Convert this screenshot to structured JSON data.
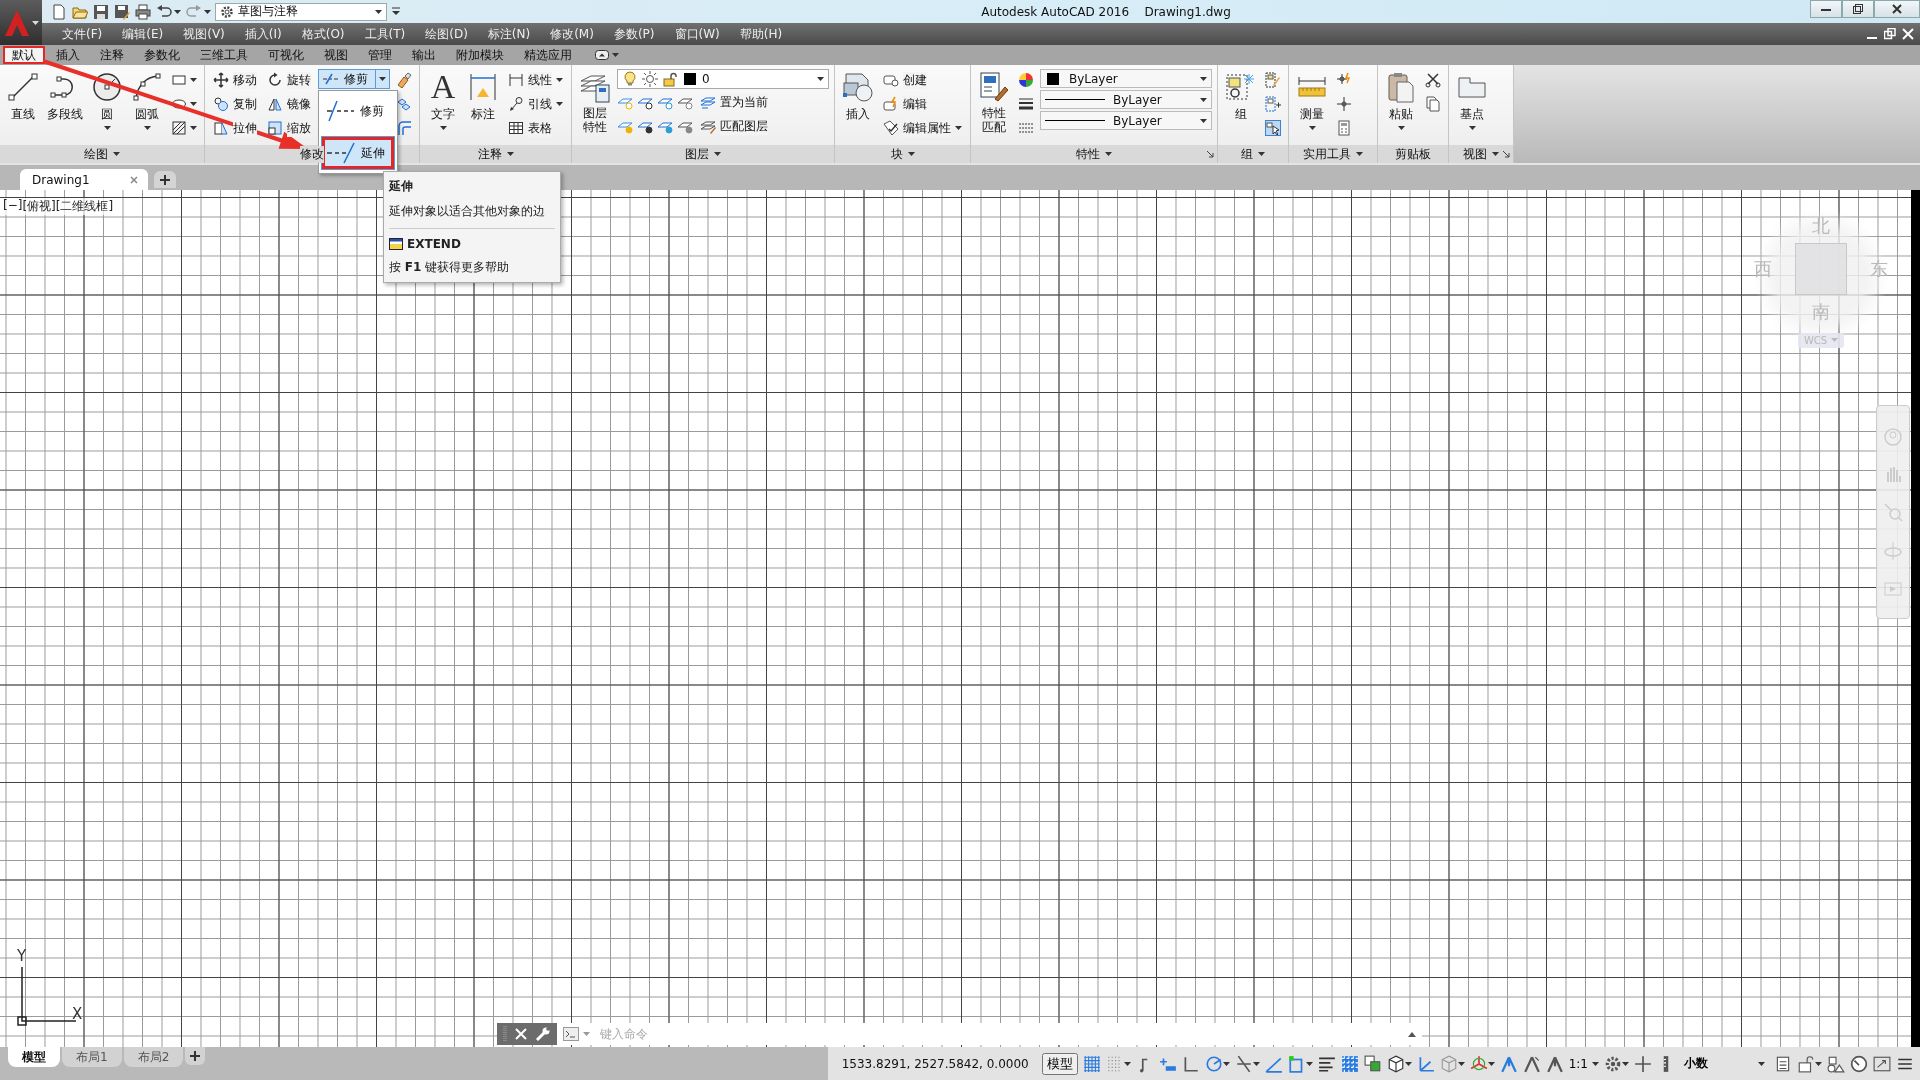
{
  "title_bar": {
    "workspace": "草图与注释",
    "app_name": "Autodesk AutoCAD 2016",
    "document": "Drawing1.dwg"
  },
  "menu_bar": [
    "文件(F)",
    "编辑(E)",
    "视图(V)",
    "插入(I)",
    "格式(O)",
    "工具(T)",
    "绘图(D)",
    "标注(N)",
    "修改(M)",
    "参数(P)",
    "窗口(W)",
    "帮助(H)"
  ],
  "ribbon_tabs": [
    {
      "label": "默认",
      "selected": true,
      "marked": true
    },
    {
      "label": "插入",
      "selected": false,
      "marked": false
    },
    {
      "label": "注释",
      "selected": false,
      "marked": false
    },
    {
      "label": "参数化",
      "selected": false,
      "marked": false
    },
    {
      "label": "三维工具",
      "selected": false,
      "marked": false
    },
    {
      "label": "可视化",
      "selected": false,
      "marked": false
    },
    {
      "label": "视图",
      "selected": false,
      "marked": false
    },
    {
      "label": "管理",
      "selected": false,
      "marked": false
    },
    {
      "label": "输出",
      "selected": false,
      "marked": false
    },
    {
      "label": "附加模块",
      "selected": false,
      "marked": false
    },
    {
      "label": "精选应用",
      "selected": false,
      "marked": false
    }
  ],
  "panels": [
    {
      "kind": "draw",
      "title": "绘图",
      "menu": true,
      "launcher": false,
      "large": [
        {
          "label": "直线",
          "caret": false
        },
        {
          "label": "多段线",
          "caret": false
        },
        {
          "label": "圆",
          "caret": true
        },
        {
          "label": "圆弧",
          "caret": true
        }
      ]
    },
    {
      "kind": "modify",
      "title": "修改",
      "menu": false,
      "launcher": false,
      "small": [
        {
          "label": "移动",
          "caret": false
        },
        {
          "label": "复制",
          "caret": false
        },
        {
          "label": "拉伸",
          "caret": false
        },
        {
          "label": "旋转",
          "caret": false
        },
        {
          "label": "镜像",
          "caret": false
        },
        {
          "label": "缩放",
          "caret": false
        }
      ],
      "split_button": {
        "label": "修剪",
        "expanded": true,
        "options": [
          {
            "label": "修剪",
            "selected": false,
            "marked": false
          },
          {
            "label": "延伸",
            "selected": true,
            "marked": true
          }
        ]
      }
    },
    {
      "kind": "annotate",
      "title": "注释",
      "menu": true,
      "launcher": false,
      "large": [
        {
          "label": "文字",
          "glyph": "A",
          "caret": true
        },
        {
          "label": "标注",
          "caret": false
        }
      ],
      "small": [
        {
          "label": "线性",
          "caret": true
        },
        {
          "label": "引线",
          "caret": true
        },
        {
          "label": "表格",
          "caret": false
        }
      ]
    },
    {
      "kind": "layers",
      "title": "图层",
      "menu": true,
      "launcher": false,
      "large": [
        {
          "label": "图层特性",
          "caret": false
        }
      ],
      "combo": {
        "value": "0"
      },
      "small": [
        {
          "label": "置为当前",
          "caret": false
        },
        {
          "label": "匹配图层",
          "caret": false
        }
      ]
    },
    {
      "kind": "block",
      "title": "块",
      "menu": true,
      "launcher": false,
      "large": [
        {
          "label": "插入",
          "caret": false
        }
      ],
      "small": [
        {
          "label": "创建",
          "caret": false
        },
        {
          "label": "编辑",
          "caret": false
        },
        {
          "label": "编辑属性",
          "caret": true
        }
      ]
    },
    {
      "kind": "properties",
      "title": "特性",
      "menu": true,
      "launcher": true,
      "large": [
        {
          "label": "特性匹配",
          "caret": false
        }
      ],
      "combos": [
        {
          "value": "ByLayer",
          "kind": "color"
        },
        {
          "value": "ByLayer",
          "kind": "lineweight"
        },
        {
          "value": "ByLayer",
          "kind": "linetype"
        }
      ]
    },
    {
      "kind": "group",
      "title": "组",
      "menu": true,
      "launcher": false,
      "large": [
        {
          "label": "组",
          "caret": false
        }
      ]
    },
    {
      "kind": "utilities",
      "title": "实用工具",
      "menu": true,
      "launcher": false,
      "large": [
        {
          "label": "测量",
          "caret": true
        }
      ]
    },
    {
      "kind": "clipboard",
      "title": "剪贴板",
      "menu": false,
      "launcher": false,
      "large": [
        {
          "label": "粘贴",
          "caret": true
        }
      ]
    },
    {
      "kind": "view",
      "title": "视图",
      "menu": true,
      "launcher": true,
      "large": [
        {
          "label": "基点",
          "caret": true
        }
      ]
    }
  ],
  "tooltip": {
    "title": "延伸",
    "description": "延伸对象以适合其他对象的边",
    "command": "EXTEND",
    "help": "按 **F1** 键获得更多帮助"
  },
  "document_tabs": [
    {
      "label": "Drawing1",
      "selected": true
    }
  ],
  "viewport": {
    "controls": [
      "[−]",
      "[俯视]",
      "[二维线框]"
    ],
    "view_cube": {
      "north": "北",
      "west": "西",
      "east": "东",
      "south": "南",
      "coordinate_system": "WCS"
    },
    "ucs": {
      "x_axis": "X",
      "y_axis": "Y"
    }
  },
  "command_line": {
    "placeholder": "键入命令"
  },
  "layout_tabs": [
    {
      "label": "模型",
      "selected": true
    },
    {
      "label": "布局1",
      "selected": false
    },
    {
      "label": "布局2",
      "selected": false
    }
  ],
  "status_bar": {
    "coordinates": "1533.8291, 2527.5842, 0.0000",
    "space": "模型",
    "scale": "1:1",
    "units": "小数"
  }
}
